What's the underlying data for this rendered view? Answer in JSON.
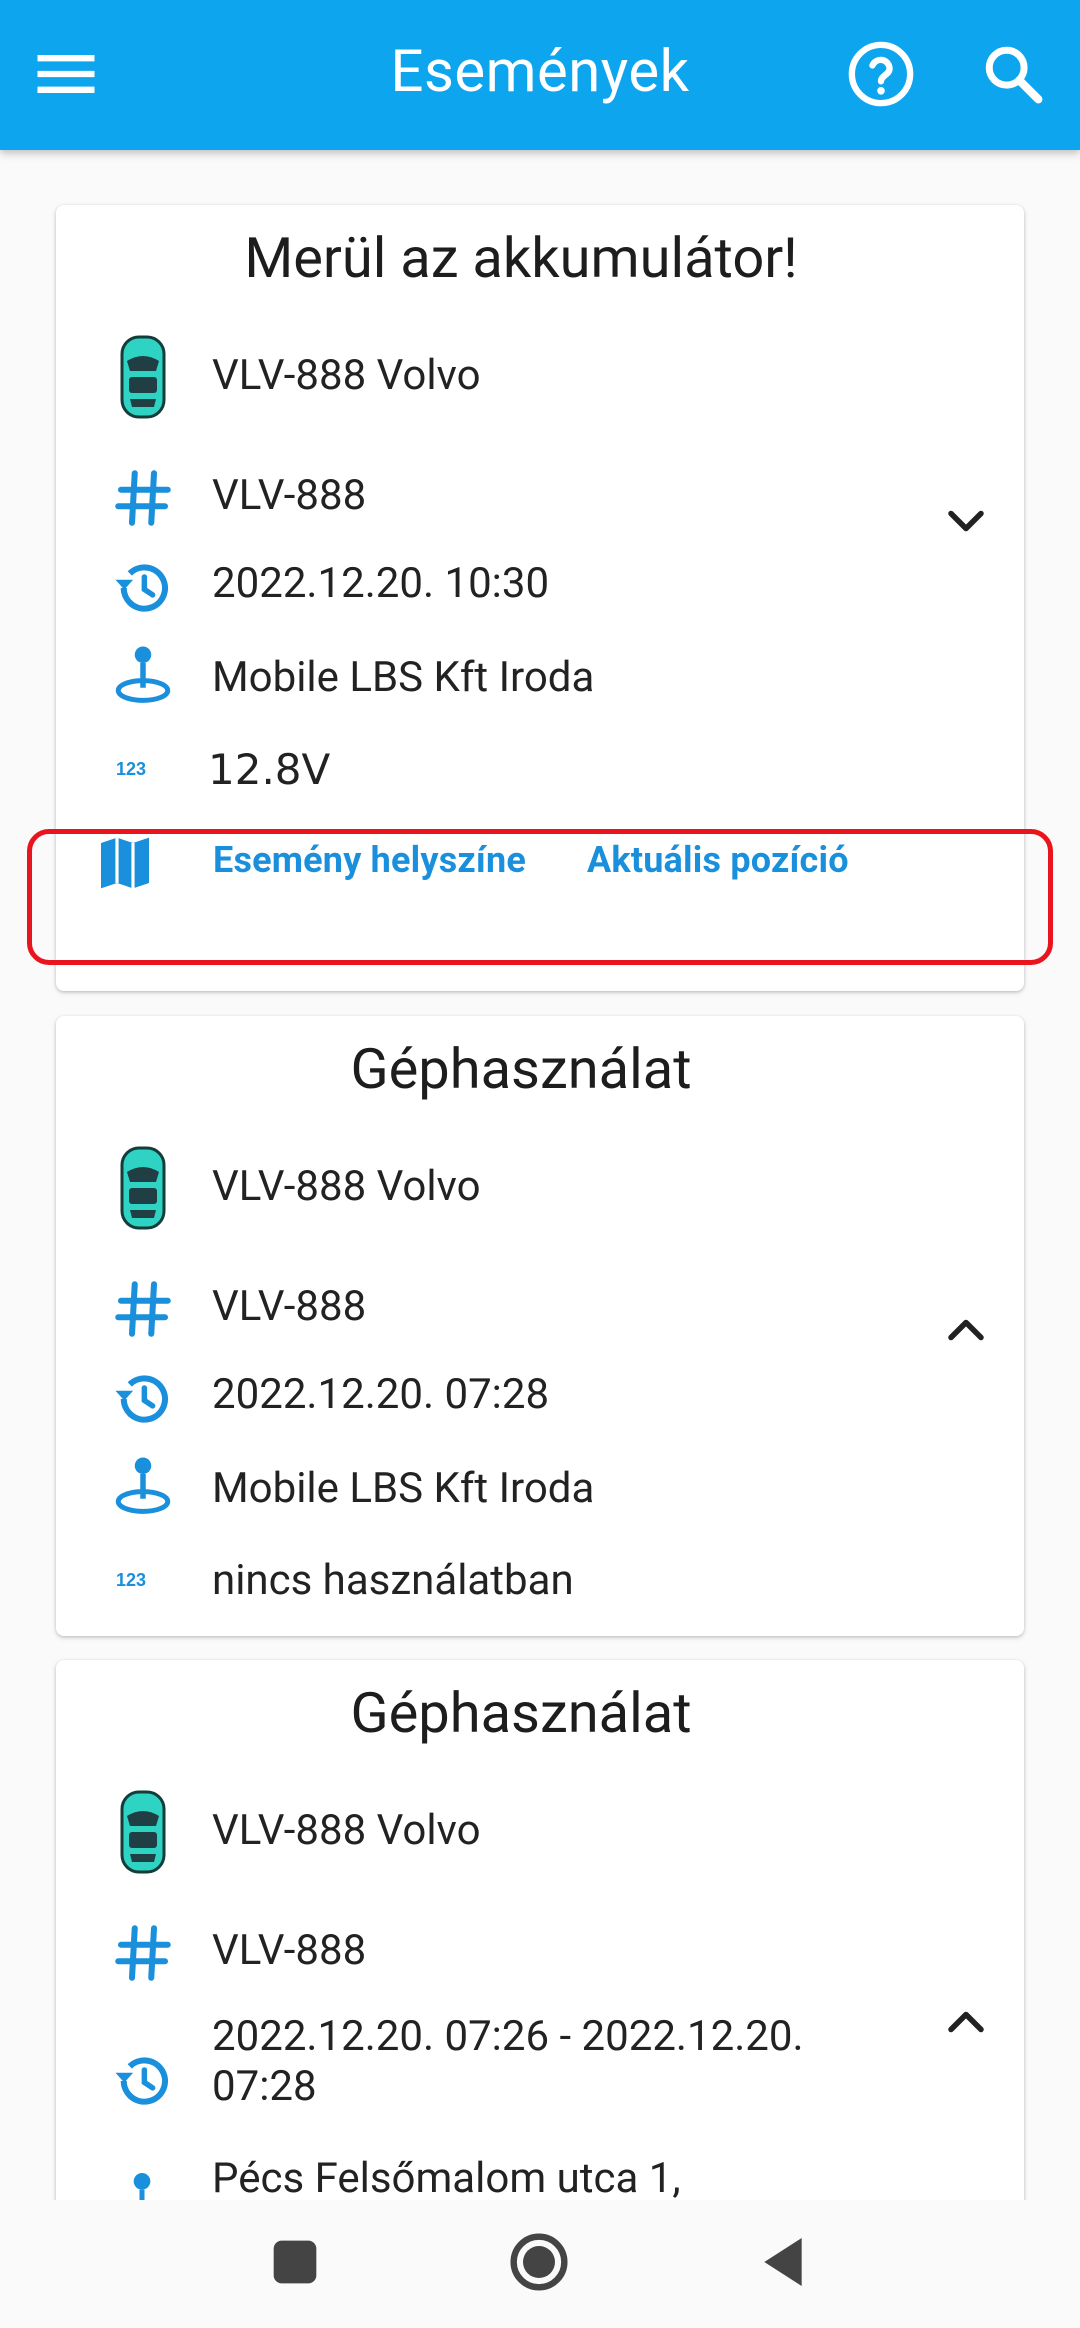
{
  "appbar": {
    "title": "Események",
    "icons": [
      "hamburger-menu-icon",
      "help-circle-icon",
      "search-icon"
    ],
    "color": "#0ea5ef"
  },
  "events": [
    {
      "title": "Merül az akkumulátor!",
      "vehicle": "VLV-888 Volvo",
      "plate": "VLV-888",
      "time": "2022.12.20. 10:30",
      "location": "Mobile LBS Kft Iroda",
      "value": "12.8V",
      "expand_state": "collapsed",
      "actions": {
        "event_location": "Esemény helyszíne",
        "current_position": "Aktuális pozíció"
      }
    },
    {
      "title": "Géphasználat",
      "vehicle": "VLV-888 Volvo",
      "plate": "VLV-888",
      "time": "2022.12.20. 07:28",
      "location": "Mobile LBS Kft Iroda",
      "value": "nincs használatban",
      "expand_state": "expanded"
    },
    {
      "title": "Géphasználat",
      "vehicle": "VLV-888 Volvo",
      "plate": "VLV-888",
      "time": "2022.12.20. 07:26 - 2022.12.20. 07:28",
      "location": "Pécs Felsőmalom utca 1,",
      "expand_state": "expanded"
    }
  ],
  "colors": {
    "accent": "#1a8fdc",
    "highlight": "#e8141e",
    "car": "#2fd3c3"
  },
  "navbar": {
    "icons": [
      "recents-square-icon",
      "home-circle-icon",
      "back-triangle-icon"
    ]
  }
}
